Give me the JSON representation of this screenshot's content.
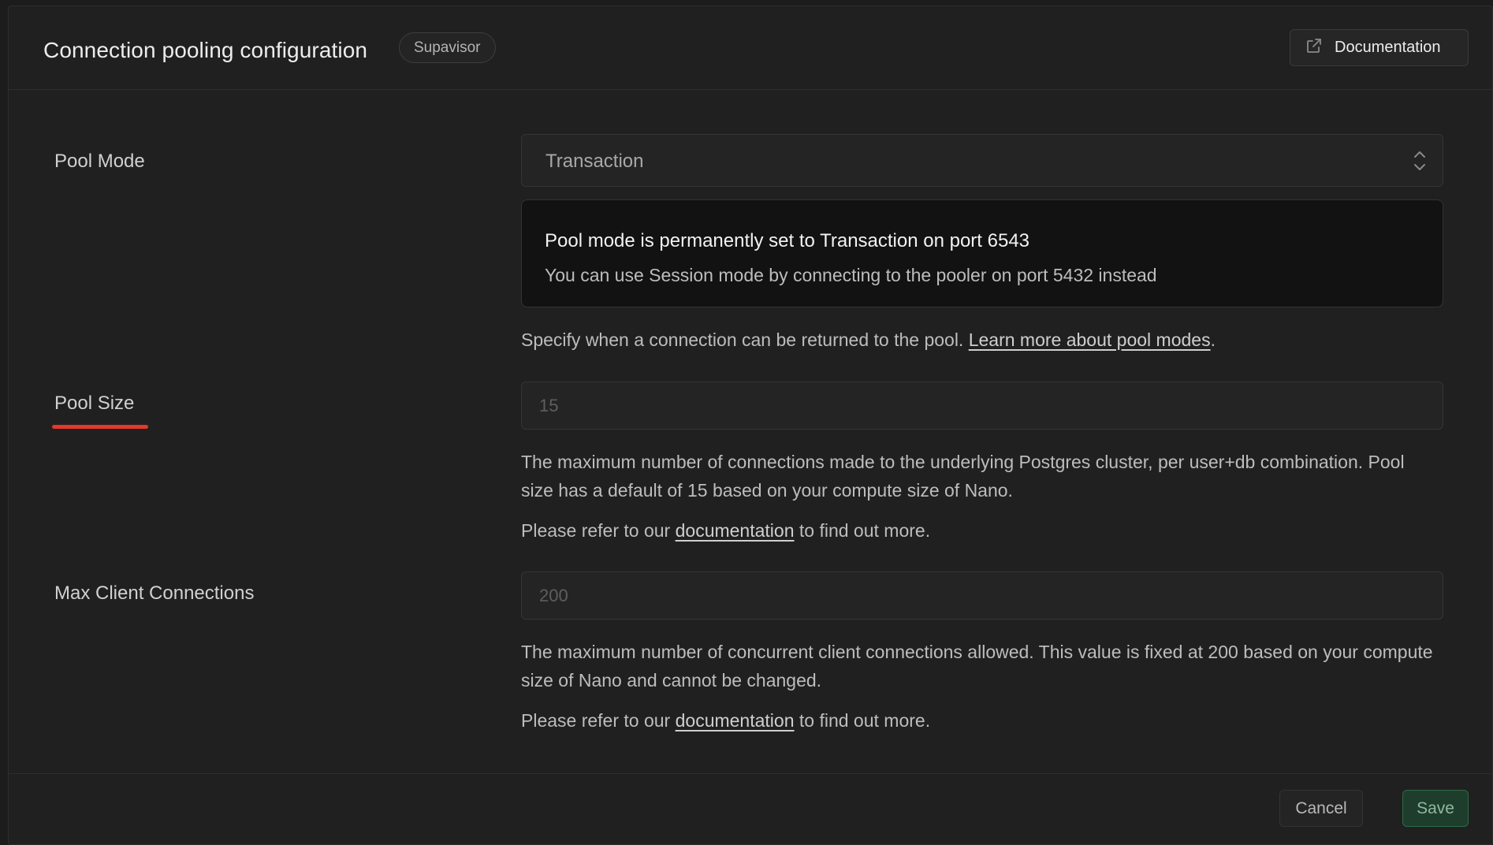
{
  "header": {
    "title": "Connection pooling configuration",
    "badge": "Supavisor",
    "documentation_button": "Documentation",
    "documentation_icon": "external-link-icon"
  },
  "pool_mode": {
    "label": "Pool Mode",
    "value": "Transaction",
    "alert_title": "Pool mode is permanently set to Transaction on port 6543",
    "alert_body": "You can use Session mode by connecting to the pooler on port 5432 instead",
    "help_text": "Specify when a connection can be returned to the pool. ",
    "help_link": "Learn more about pool modes",
    "help_suffix": "."
  },
  "pool_size": {
    "label": "Pool Size",
    "placeholder": "15",
    "help_text": "The maximum number of connections made to the underlying Postgres cluster, per user+db combination. Pool size has a default of 15 based on your compute size of Nano.",
    "refer_prefix": "Please refer to our ",
    "refer_link": "documentation",
    "refer_suffix": " to find out more.",
    "highlight_color": "#e5382b"
  },
  "max_client_connections": {
    "label": "Max Client Connections",
    "placeholder": "200",
    "help_text": "The maximum number of concurrent client connections allowed. This value is fixed at 200 based on your compute size of Nano and cannot be changed.",
    "refer_prefix": "Please refer to our ",
    "refer_link": "documentation",
    "refer_suffix": " to find out more."
  },
  "footer": {
    "cancel_label": "Cancel",
    "save_label": "Save",
    "save_color": "#1f3d2c"
  }
}
